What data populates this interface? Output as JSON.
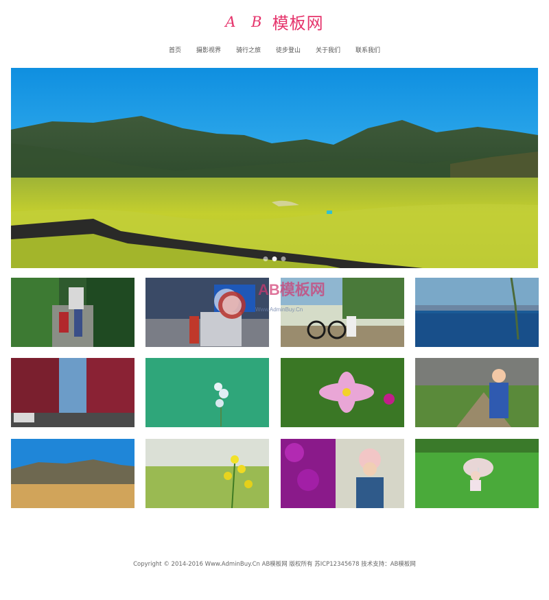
{
  "logo": {
    "ab": "A B",
    "cn": "模板网"
  },
  "nav": {
    "items": [
      "首页",
      "摄影视界",
      "骑行之旅",
      "徒步登山",
      "关于我们",
      "联系我们"
    ]
  },
  "banner": {
    "slides": 3,
    "active_slide": 2
  },
  "gallery": {
    "watermark": "AB模板网",
    "watermark_url": "Www.AdminBuy.Cn",
    "photos": [
      {
        "subject": "stone-steps-bag"
      },
      {
        "subject": "road-sign"
      },
      {
        "subject": "bicycle-milestone"
      },
      {
        "subject": "lake-tree"
      },
      {
        "subject": "red-tree-street"
      },
      {
        "subject": "white-flower"
      },
      {
        "subject": "pink-cosmos"
      },
      {
        "subject": "girl-path"
      },
      {
        "subject": "mountain-grassland"
      },
      {
        "subject": "rapeseed-flowers"
      },
      {
        "subject": "purple-flowers-girl"
      },
      {
        "subject": "child-umbrella"
      }
    ]
  },
  "footer": {
    "text": "Copyright © 2014-2016 Www.AdminBuy.Cn AB模板网 版权所有 苏ICP12345678 技术支持：AB模板网"
  },
  "colors": {
    "brand": "#e5336b",
    "text": "#555555",
    "sky": "#1aa3e6",
    "grass": "#b7c72a"
  }
}
